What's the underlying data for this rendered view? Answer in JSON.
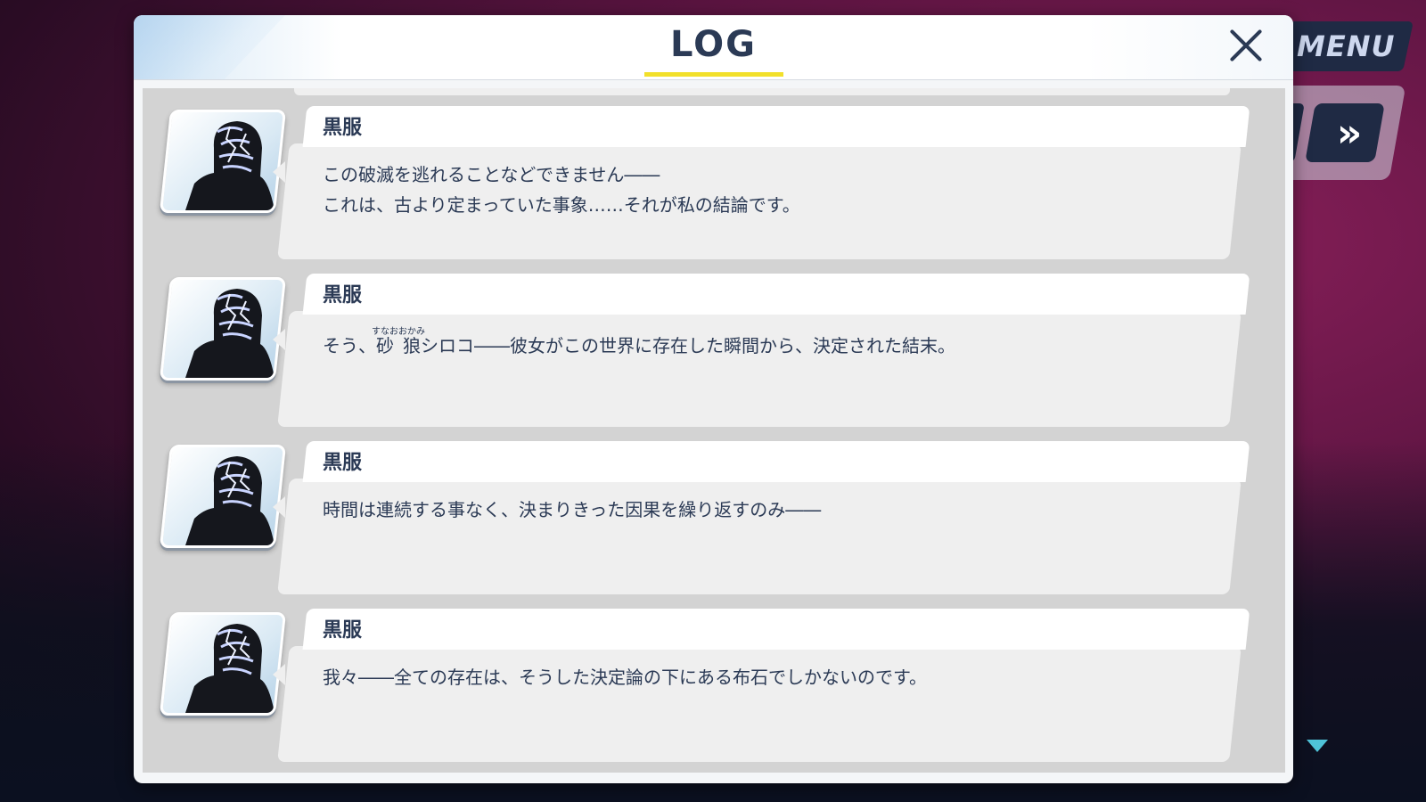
{
  "hud": {
    "menu_label": "MENU",
    "fast_forward_label": "»"
  },
  "log": {
    "title": "LOG",
    "close_label": "close",
    "entries": [
      {
        "speaker": "黒服",
        "lines": [
          "この破滅を逃れることなどできません――",
          "これは、古より定まっていた事象……それが私の結論です。"
        ]
      },
      {
        "speaker": "黒服",
        "line_pre": "そう、",
        "ruby_base": "砂狼",
        "ruby_text": "すなおおかみ",
        "line_post": "シロコ――彼女がこの世界に存在した瞬間から、決定された結末。"
      },
      {
        "speaker": "黒服",
        "lines": [
          "時間は連続する事なく、決まりきった因果を繰り返すのみ――"
        ]
      },
      {
        "speaker": "黒服",
        "lines": [
          "我々――全ての存在は、そうした決定論の下にある布石でしかないのです。"
        ]
      }
    ]
  },
  "colors": {
    "title_text": "#2b3a55",
    "underline": "#f2e02a",
    "scroll_indicator": "#4fc3d8"
  }
}
